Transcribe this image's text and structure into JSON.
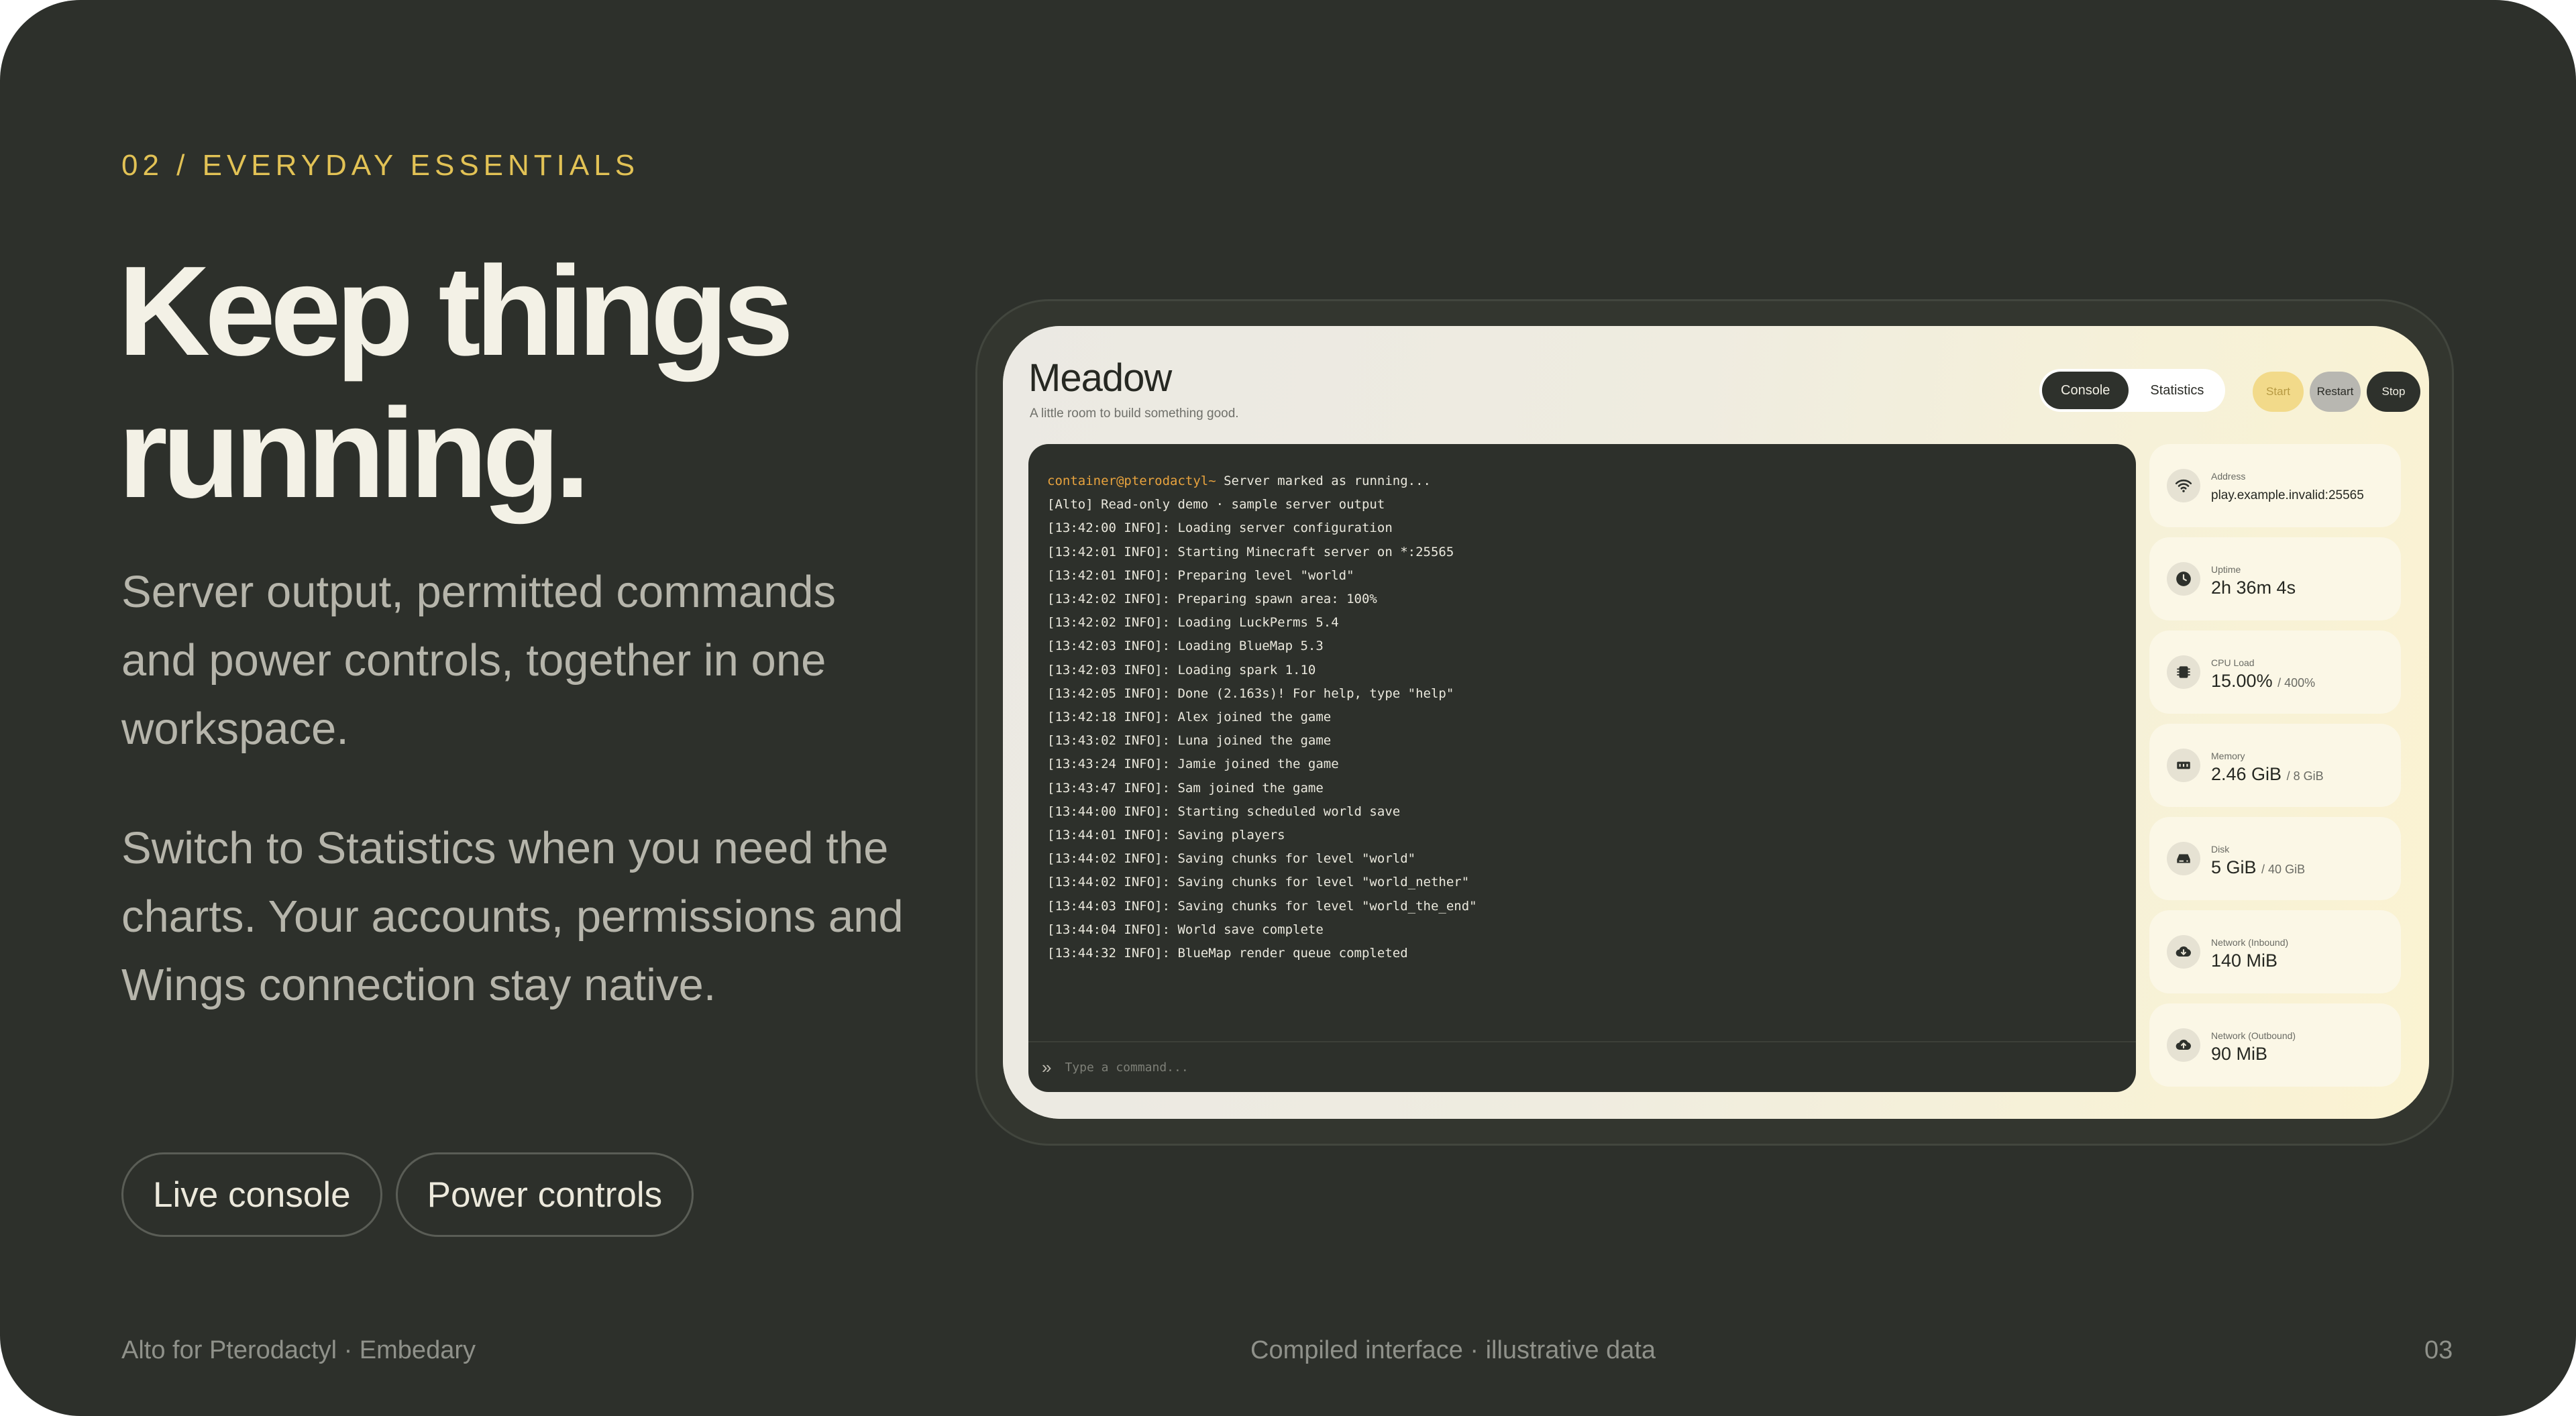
{
  "slide": {
    "eyebrow": "02 / EVERYDAY ESSENTIALS",
    "headline_line1": "Keep things",
    "headline_line2": "running.",
    "paragraph1": "Server output, permitted commands and power controls, together in one workspace.",
    "paragraph2": "Switch to Statistics when you need the charts. Your accounts, permissions and Wings connection stay native.",
    "pills": [
      "Live console",
      "Power controls"
    ]
  },
  "footer": {
    "left": "Alto for Pterodactyl · Embedary",
    "center": "Compiled interface · illustrative data",
    "page_number": "03"
  },
  "app": {
    "server_name": "Meadow",
    "server_description": "A little room to build something good.",
    "tabs": [
      {
        "label": "Console",
        "active": true
      },
      {
        "label": "Statistics",
        "active": false
      }
    ],
    "power": {
      "start": "Start",
      "restart": "Restart",
      "stop": "Stop"
    },
    "console": {
      "prompt": "container@pterodactyl~",
      "first_line_rest": " Server marked as running...",
      "lines": [
        "[Alto] Read-only demo · sample server output",
        "[13:42:00 INFO]: Loading server configuration",
        "[13:42:01 INFO]: Starting Minecraft server on *:25565",
        "[13:42:01 INFO]: Preparing level \"world\"",
        "[13:42:02 INFO]: Preparing spawn area: 100%",
        "[13:42:02 INFO]: Loading LuckPerms 5.4",
        "[13:42:03 INFO]: Loading BlueMap 5.3",
        "[13:42:03 INFO]: Loading spark 1.10",
        "[13:42:05 INFO]: Done (2.163s)! For help, type \"help\"",
        "[13:42:18 INFO]: Alex joined the game",
        "[13:43:02 INFO]: Luna joined the game",
        "[13:43:24 INFO]: Jamie joined the game",
        "[13:43:47 INFO]: Sam joined the game",
        "[13:44:00 INFO]: Starting scheduled world save",
        "[13:44:01 INFO]: Saving players",
        "[13:44:02 INFO]: Saving chunks for level \"world\"",
        "[13:44:02 INFO]: Saving chunks for level \"world_nether\"",
        "[13:44:03 INFO]: Saving chunks for level \"world_the_end\"",
        "[13:44:04 INFO]: World save complete",
        "[13:44:32 INFO]: BlueMap render queue completed"
      ],
      "command_placeholder": "Type a command..."
    },
    "stats": {
      "address": {
        "label": "Address",
        "value": "play.example.invalid:25565",
        "icon": "wifi-icon"
      },
      "uptime": {
        "label": "Uptime",
        "value": "2h 36m 4s",
        "icon": "clock-icon"
      },
      "cpu": {
        "label": "CPU Load",
        "value": "15.00%",
        "limit": "/ 400%",
        "icon": "cpu-icon"
      },
      "memory": {
        "label": "Memory",
        "value": "2.46 GiB",
        "limit": "/ 8 GiB",
        "icon": "memory-icon"
      },
      "disk": {
        "label": "Disk",
        "value": "5 GiB",
        "limit": "/ 40 GiB",
        "icon": "disk-icon"
      },
      "net_in": {
        "label": "Network (Inbound)",
        "value": "140 MiB",
        "icon": "cloud-download-icon"
      },
      "net_out": {
        "label": "Network (Outbound)",
        "value": "90 MiB",
        "icon": "cloud-upload-icon"
      }
    }
  }
}
